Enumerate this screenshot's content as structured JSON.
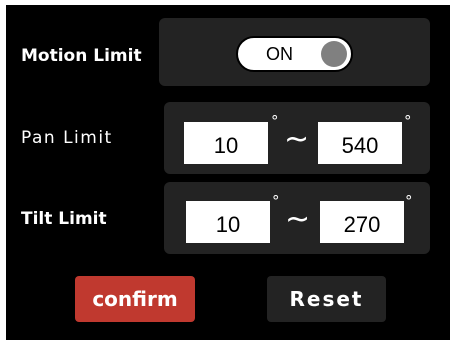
{
  "motion_limit": {
    "label": "Motion Limit",
    "toggle_text": "ON",
    "state": "on"
  },
  "pan_limit": {
    "label": "Pan Limit",
    "min": "10",
    "max": "540",
    "degree_symbol": "°",
    "separator": "~"
  },
  "tilt_limit": {
    "label": "Tilt Limit",
    "min": "10",
    "max": "270",
    "degree_symbol": "°",
    "separator": "~"
  },
  "buttons": {
    "confirm": "confirm",
    "reset": "Reset"
  },
  "colors": {
    "background": "#000000",
    "row_background": "#232323",
    "confirm_button": "#c0392f",
    "toggle_knob": "#808080"
  }
}
